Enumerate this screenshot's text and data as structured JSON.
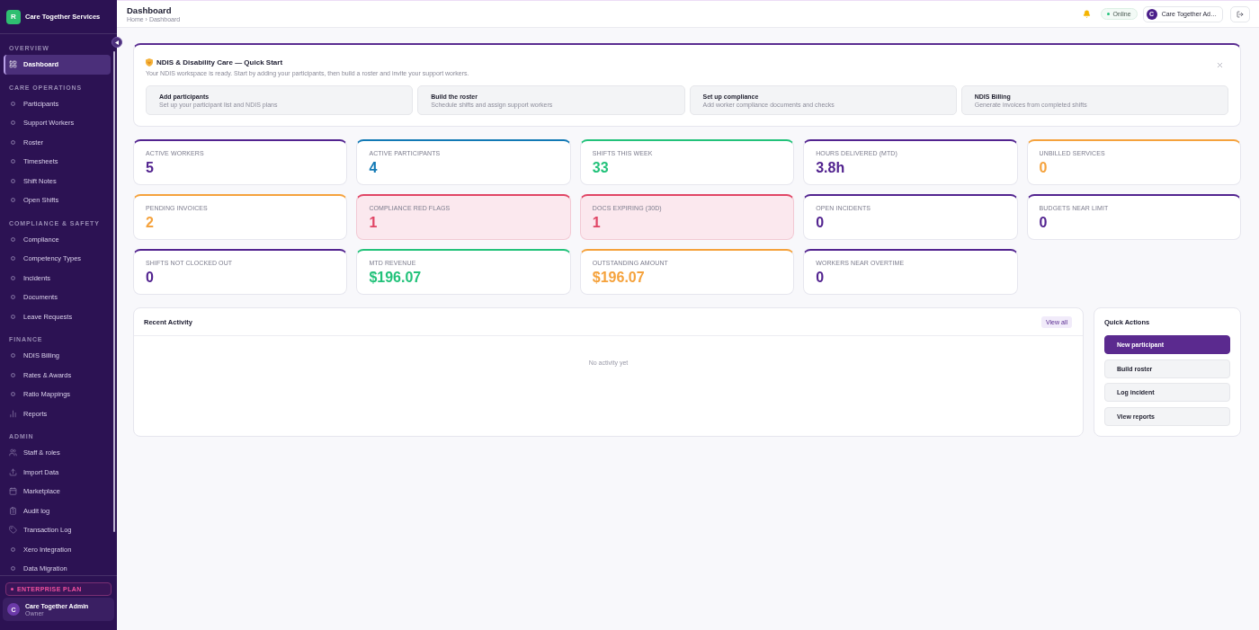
{
  "sidebar": {
    "brand": {
      "logo": "R",
      "name": "Care Together Services"
    },
    "sections": [
      {
        "title": "OVERVIEW",
        "items": [
          {
            "label": "Dashboard",
            "kind": "grid",
            "selected": true
          }
        ]
      },
      {
        "title": "CARE OPERATIONS",
        "items": [
          {
            "label": "Participants",
            "kind": "ring",
            "selected": false
          },
          {
            "label": "Support Workers",
            "kind": "ring",
            "selected": false
          },
          {
            "label": "Roster",
            "kind": "ring",
            "selected": false
          },
          {
            "label": "Timesheets",
            "kind": "ring",
            "selected": false
          },
          {
            "label": "Shift Notes",
            "kind": "ring",
            "selected": false
          },
          {
            "label": "Open Shifts",
            "kind": "ring",
            "selected": false
          }
        ]
      },
      {
        "title": "COMPLIANCE & SAFETY",
        "items": [
          {
            "label": "Compliance",
            "kind": "ring",
            "selected": false
          },
          {
            "label": "Competency Types",
            "kind": "ring",
            "selected": false
          },
          {
            "label": "Incidents",
            "kind": "ring",
            "selected": false
          },
          {
            "label": "Documents",
            "kind": "ring",
            "selected": false
          },
          {
            "label": "Leave Requests",
            "kind": "ring",
            "selected": false
          }
        ]
      },
      {
        "title": "FINANCE",
        "items": [
          {
            "label": "NDIS Billing",
            "kind": "ring",
            "selected": false
          },
          {
            "label": "Rates & Awards",
            "kind": "ring",
            "selected": false
          },
          {
            "label": "Ratio Mappings",
            "kind": "ring",
            "selected": false
          },
          {
            "label": "Reports",
            "kind": "bars",
            "selected": false
          }
        ]
      },
      {
        "title": "ADMIN",
        "items": [
          {
            "label": "Staff & roles",
            "kind": "users",
            "selected": false
          },
          {
            "label": "Import Data",
            "kind": "upload",
            "selected": false
          },
          {
            "label": "Marketplace",
            "kind": "calendar",
            "selected": false
          },
          {
            "label": "Audit log",
            "kind": "clipboard",
            "selected": false
          },
          {
            "label": "Transaction Log",
            "kind": "tag",
            "selected": false
          },
          {
            "label": "Xero Integration",
            "kind": "ring",
            "selected": false
          },
          {
            "label": "Data Migration",
            "kind": "ring",
            "selected": false
          }
        ]
      }
    ],
    "plan": "ENTERPRISE PLAN",
    "user": {
      "avatar": "C",
      "name": "Care Together Admin",
      "role": "Owner"
    }
  },
  "header": {
    "title": "Dashboard",
    "breadcrumb": "Home › Dashboard",
    "status": "Online",
    "user": {
      "avatar": "C",
      "name": "Care Together Ad…"
    }
  },
  "quick_start": {
    "title": "NDIS & Disability Care — Quick Start",
    "subtitle": "Your NDIS workspace is ready. Start by adding your participants, then build a roster and invite your support workers.",
    "steps": [
      {
        "title": "Add participants",
        "description": "Set up your participant list and NDIS plans"
      },
      {
        "title": "Build the roster",
        "description": "Schedule shifts and assign support workers"
      },
      {
        "title": "Set up compliance",
        "description": "Add worker compliance documents and checks"
      },
      {
        "title": "NDIS Billing",
        "description": "Generate invoices from completed shifts"
      }
    ]
  },
  "stats": [
    {
      "label": "ACTIVE WORKERS",
      "value": "5",
      "color": "#52238f",
      "alert": false
    },
    {
      "label": "ACTIVE PARTICIPANTS",
      "value": "4",
      "color": "#1279b5",
      "alert": false
    },
    {
      "label": "SHIFTS THIS WEEK",
      "value": "33",
      "color": "#22c27a",
      "alert": false
    },
    {
      "label": "HOURS DELIVERED (MTD)",
      "value": "3.8h",
      "color": "#52238f",
      "alert": false
    },
    {
      "label": "UNBILLED SERVICES",
      "value": "0",
      "color": "#f5a23c",
      "alert": false
    },
    {
      "label": "PENDING INVOICES",
      "value": "2",
      "color": "#f5a23c",
      "alert": false
    },
    {
      "label": "COMPLIANCE RED FLAGS",
      "value": "1",
      "color": "#e04565",
      "alert": true
    },
    {
      "label": "DOCS EXPIRING (30D)",
      "value": "1",
      "color": "#e04565",
      "alert": true
    },
    {
      "label": "OPEN INCIDENTS",
      "value": "0",
      "color": "#52238f",
      "alert": false
    },
    {
      "label": "BUDGETS NEAR LIMIT",
      "value": "0",
      "color": "#52238f",
      "alert": false
    },
    {
      "label": "SHIFTS NOT CLOCKED OUT",
      "value": "0",
      "color": "#52238f",
      "alert": false
    },
    {
      "label": "MTD REVENUE",
      "value": "$196.07",
      "color": "#22c27a",
      "alert": false
    },
    {
      "label": "OUTSTANDING AMOUNT",
      "value": "$196.07",
      "color": "#f5a23c",
      "alert": false
    },
    {
      "label": "WORKERS NEAR OVERTIME",
      "value": "0",
      "color": "#52238f",
      "alert": false
    }
  ],
  "recent_activity": {
    "title": "Recent Activity",
    "action": "View all",
    "empty": "No activity yet"
  },
  "quick_actions": {
    "title": "Quick Actions",
    "actions": [
      {
        "label": "New participant",
        "primary": true
      },
      {
        "label": "Build roster",
        "primary": false
      },
      {
        "label": "Log incident",
        "primary": false
      },
      {
        "label": "View reports",
        "primary": false
      }
    ]
  }
}
